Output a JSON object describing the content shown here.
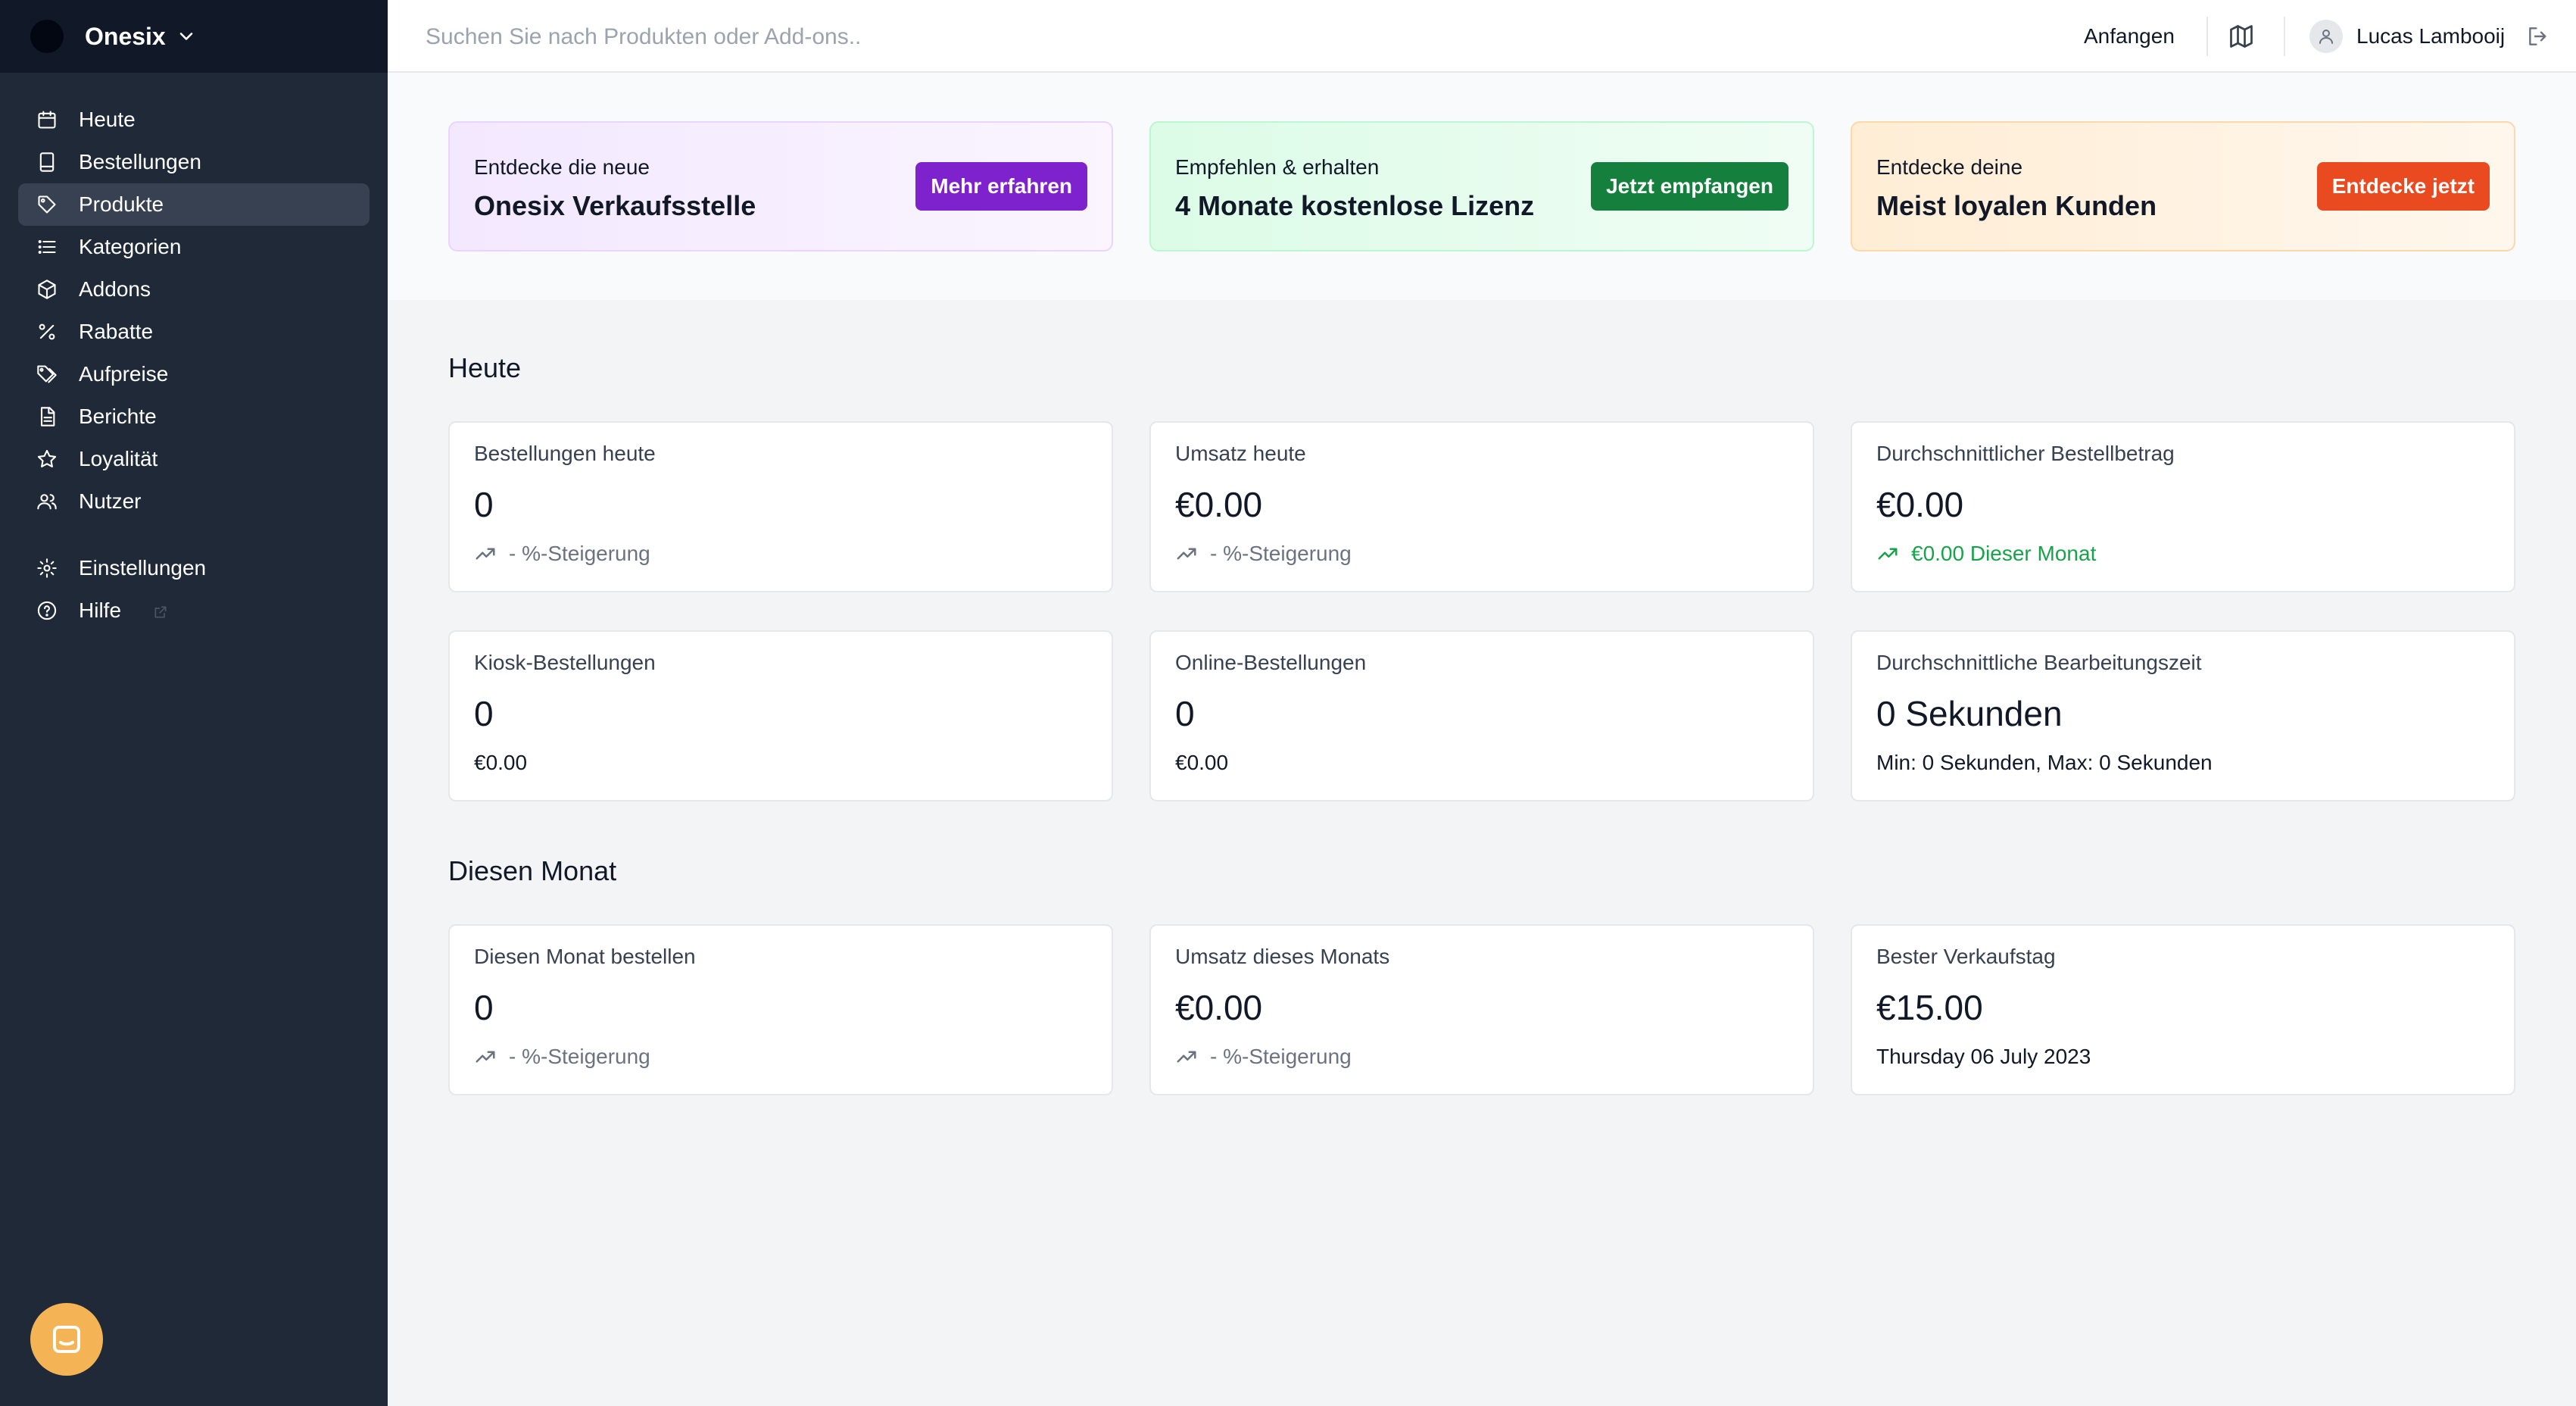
{
  "app": {
    "brand_name": "Onesix"
  },
  "sidebar": {
    "items": [
      {
        "label": "Heute",
        "icon": "calendar-icon"
      },
      {
        "label": "Bestellungen",
        "icon": "tablet-icon"
      },
      {
        "label": "Produkte",
        "icon": "tag-icon",
        "active": true
      },
      {
        "label": "Kategorien",
        "icon": "list-icon"
      },
      {
        "label": "Addons",
        "icon": "cube-icon"
      },
      {
        "label": "Rabatte",
        "icon": "percent-icon"
      },
      {
        "label": "Aufpreise",
        "icon": "tags-icon"
      },
      {
        "label": "Berichte",
        "icon": "document-icon"
      },
      {
        "label": "Loyalität",
        "icon": "star-icon"
      },
      {
        "label": "Nutzer",
        "icon": "users-icon"
      }
    ],
    "bottom_items": [
      {
        "label": "Einstellungen",
        "icon": "gear-icon"
      },
      {
        "label": "Hilfe",
        "icon": "help-circle-icon",
        "external": true
      }
    ]
  },
  "topbar": {
    "search_placeholder": "Suchen Sie nach Produkten oder Add-ons..",
    "start_link": "Anfangen",
    "user_name": "Lucas Lambooij"
  },
  "promos": [
    {
      "small": "Entdecke die neue",
      "big": "Onesix Verkaufsstelle",
      "button": "Mehr erfahren",
      "color": "#7e22ce"
    },
    {
      "small": "Empfehlen & erhalten",
      "big": "4 Monate kostenlose Lizenz",
      "button": "Jetzt empfangen",
      "color": "#15803d"
    },
    {
      "small": "Entdecke deine",
      "big": "Meist loyalen Kunden",
      "button": "Entdecke jetzt",
      "color": "#ea4a1f"
    }
  ],
  "today": {
    "title": "Heute",
    "cards": [
      {
        "label": "Bestellungen heute",
        "value": "0",
        "sub": "- %-Steigerung"
      },
      {
        "label": "Umsatz heute",
        "value": "€0.00",
        "sub": "- %-Steigerung"
      },
      {
        "label": "Durchschnittlicher Bestellbetrag",
        "value": "€0.00",
        "sub": "€0.00 Dieser Monat"
      },
      {
        "label": "Kiosk-Bestellungen",
        "value": "0",
        "sub": "€0.00"
      },
      {
        "label": "Online-Bestellungen",
        "value": "0",
        "sub": "€0.00"
      },
      {
        "label": "Durchschnittliche Bearbeitungszeit",
        "value": "0 Sekunden",
        "sub": "Min: 0 Sekunden, Max: 0 Sekunden"
      }
    ]
  },
  "month": {
    "title": "Diesen Monat",
    "cards": [
      {
        "label": "Diesen Monat bestellen",
        "value": "0",
        "sub": "- %-Steigerung"
      },
      {
        "label": "Umsatz dieses Monats",
        "value": "€0.00",
        "sub": "- %-Steigerung"
      },
      {
        "label": "Bester Verkaufstag",
        "value": "€15.00",
        "sub": "Thursday 06 July 2023"
      }
    ]
  },
  "colors": {
    "sidebar_bg": "#1f2937",
    "sidebar_active": "#374151",
    "positive_green": "#16a34a",
    "chat_bubble": "#f4b456"
  }
}
